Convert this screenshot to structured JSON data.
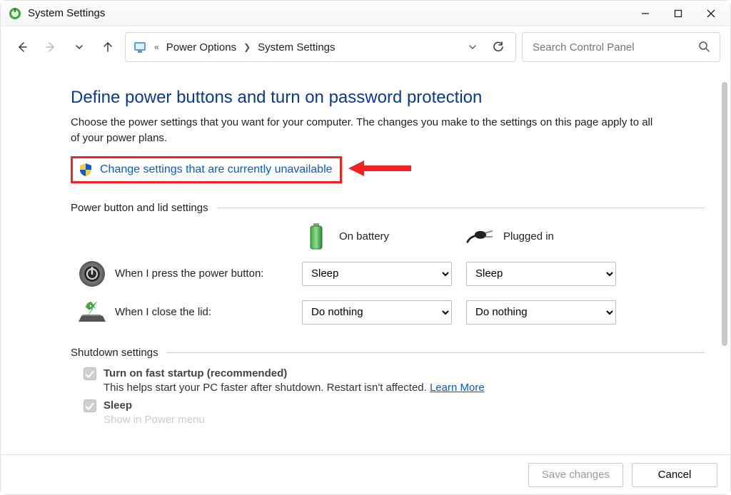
{
  "window": {
    "title": "System Settings"
  },
  "breadcrumb": {
    "prefix_glyph": "«",
    "items": [
      "Power Options",
      "System Settings"
    ]
  },
  "search": {
    "placeholder": "Search Control Panel"
  },
  "page": {
    "heading": "Define power buttons and turn on password protection",
    "subheading": "Choose the power settings that you want for your computer. The changes you make to the settings on this page apply to all of your power plans.",
    "change_settings_link": "Change settings that are currently unavailable"
  },
  "section1": {
    "title": "Power button and lid settings",
    "col_battery": "On battery",
    "col_plugged": "Plugged in",
    "rows": [
      {
        "label": "When I press the power button:",
        "battery_value": "Sleep",
        "plugged_value": "Sleep"
      },
      {
        "label": "When I close the lid:",
        "battery_value": "Do nothing",
        "plugged_value": "Do nothing"
      }
    ]
  },
  "section2": {
    "title": "Shutdown settings",
    "items": [
      {
        "label": "Turn on fast startup (recommended)",
        "checked": true,
        "desc_prefix": "This helps start your PC faster after shutdown. Restart isn't affected. ",
        "desc_link": "Learn More"
      },
      {
        "label": "Sleep",
        "checked": true,
        "desc_prefix_partial": "Show in Power menu"
      }
    ]
  },
  "buttons": {
    "save": "Save changes",
    "cancel": "Cancel"
  },
  "colors": {
    "heading": "#0a3a8f",
    "link": "#0a5bcc",
    "highlight": "#f22222"
  }
}
